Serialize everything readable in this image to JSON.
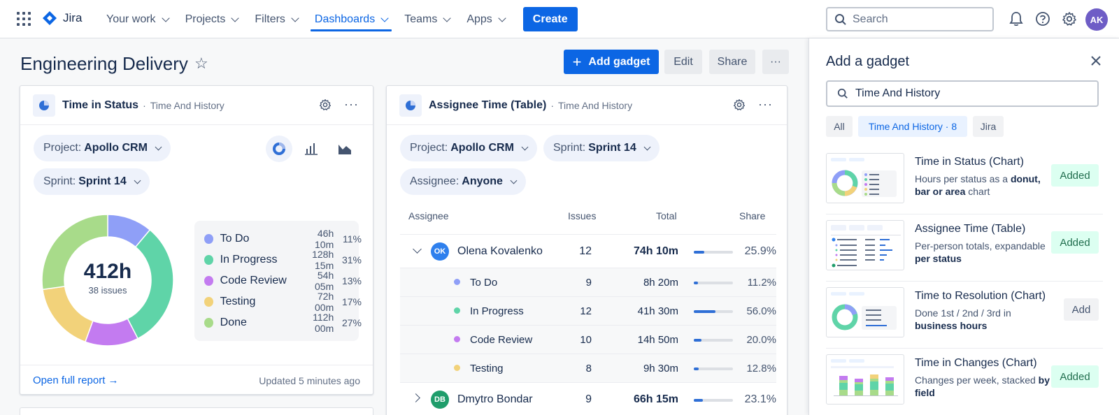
{
  "nav": {
    "product": "Jira",
    "items": [
      {
        "label": "Your work",
        "active": false
      },
      {
        "label": "Projects",
        "active": false
      },
      {
        "label": "Filters",
        "active": false
      },
      {
        "label": "Dashboards",
        "active": true
      },
      {
        "label": "Teams",
        "active": false
      },
      {
        "label": "Apps",
        "active": false
      }
    ],
    "create_label": "Create",
    "search_placeholder": "Search",
    "avatar_initials": "AK",
    "icons": [
      "bell-icon",
      "help-icon",
      "settings-icon"
    ]
  },
  "page": {
    "title": "Engineering Delivery",
    "add_gadget_label": "Add gadget",
    "edit_label": "Edit",
    "share_label": "Share",
    "more_label": "···"
  },
  "time_in_status": {
    "title": "Time in Status",
    "subtitle": "Time And History",
    "filters": {
      "project_label": "Project:",
      "project_value": "Apollo CRM",
      "sprint_label": "Sprint:",
      "sprint_value": "Sprint 14"
    },
    "chart_type_icons": [
      "donut-chart-icon",
      "bar-chart-icon",
      "area-chart-icon"
    ],
    "total": "412h",
    "issues": "38 issues",
    "legend": [
      {
        "name": "To Do",
        "time": "46h 10m",
        "pct": "11%",
        "color": "#8f9ff7"
      },
      {
        "name": "In Progress",
        "time": "128h 15m",
        "pct": "31%",
        "color": "#5fd4a8"
      },
      {
        "name": "Code Review",
        "time": "54h 05m",
        "pct": "13%",
        "color": "#c37bf0"
      },
      {
        "name": "Testing",
        "time": "72h 00m",
        "pct": "17%",
        "color": "#f2d27a"
      },
      {
        "name": "Done",
        "time": "112h 00m",
        "pct": "27%",
        "color": "#a8db8a"
      }
    ],
    "footer_link": "Open full report →",
    "updated": "Updated 5 minutes ago"
  },
  "chart_data": {
    "type": "pie",
    "categories": [
      "To Do",
      "In Progress",
      "Code Review",
      "Testing",
      "Done"
    ],
    "values": [
      11,
      31,
      13,
      17,
      27
    ],
    "title": "Time in Status"
  },
  "assignee_time": {
    "title": "Assignee Time (Table)",
    "subtitle": "Time And History",
    "filters": {
      "project_label": "Project:",
      "project_value": "Apollo CRM",
      "sprint_label": "Sprint:",
      "sprint_value": "Sprint 14",
      "assignee_label": "Assignee:",
      "assignee_value": "Anyone"
    },
    "columns": [
      "Assignee",
      "Issues",
      "Total",
      "Share"
    ],
    "rows": [
      {
        "initials": "OK",
        "name": "Olena Kovalenko",
        "issues": "12",
        "total": "74h 10m",
        "share": "25.9%",
        "share_value": 25.9,
        "avatar_color": "#2f80ed",
        "expanded": true
      },
      {
        "name": "To Do",
        "issues": "9",
        "total": "8h 20m",
        "share": "11.2%",
        "share_value": 11.2,
        "dot_color": "#8f9ff7"
      },
      {
        "name": "In Progress",
        "issues": "12",
        "total": "41h 30m",
        "share": "56.0%",
        "share_value": 56.0,
        "dot_color": "#5fd4a8"
      },
      {
        "name": "Code Review",
        "issues": "10",
        "total": "14h 50m",
        "share": "20.0%",
        "share_value": 20.0,
        "dot_color": "#c37bf0"
      },
      {
        "name": "Testing",
        "issues": "8",
        "total": "9h 30m",
        "share": "12.8%",
        "share_value": 12.8,
        "dot_color": "#f2d27a"
      },
      {
        "initials": "DB",
        "name": "Dmytro Bondar",
        "issues": "9",
        "total": "66h 15m",
        "share": "23.1%",
        "share_value": 23.1,
        "avatar_color": "#1f9d6b",
        "expanded": false
      }
    ]
  },
  "panel": {
    "title": "Add a gadget",
    "search_value": "Time And History",
    "chips": [
      {
        "label": "All",
        "active": false
      },
      {
        "label": "Time And History · 8",
        "active": true
      },
      {
        "label": "Jira",
        "active": false
      }
    ],
    "gadgets": [
      {
        "name": "Time in Status (Chart)",
        "desc_plain": "Hours per status as a ",
        "desc_bold": "donut, bar or area",
        "desc_tail": " chart",
        "button": "Added",
        "added": true
      },
      {
        "name": "Assignee Time (Table)",
        "desc_plain": "Per-person totals, expandable ",
        "desc_bold": "per status",
        "desc_tail": "",
        "button": "Added",
        "added": true
      },
      {
        "name": "Time to Resolution (Chart)",
        "desc_plain": "Done 1st / 2nd / 3rd in ",
        "desc_bold": "business hours",
        "desc_tail": "",
        "button": "Add",
        "added": false
      },
      {
        "name": "Time in Changes (Chart)",
        "desc_plain": "Changes per week, stacked ",
        "desc_bold": "by field",
        "desc_tail": "",
        "button": "Added",
        "added": true
      }
    ]
  }
}
